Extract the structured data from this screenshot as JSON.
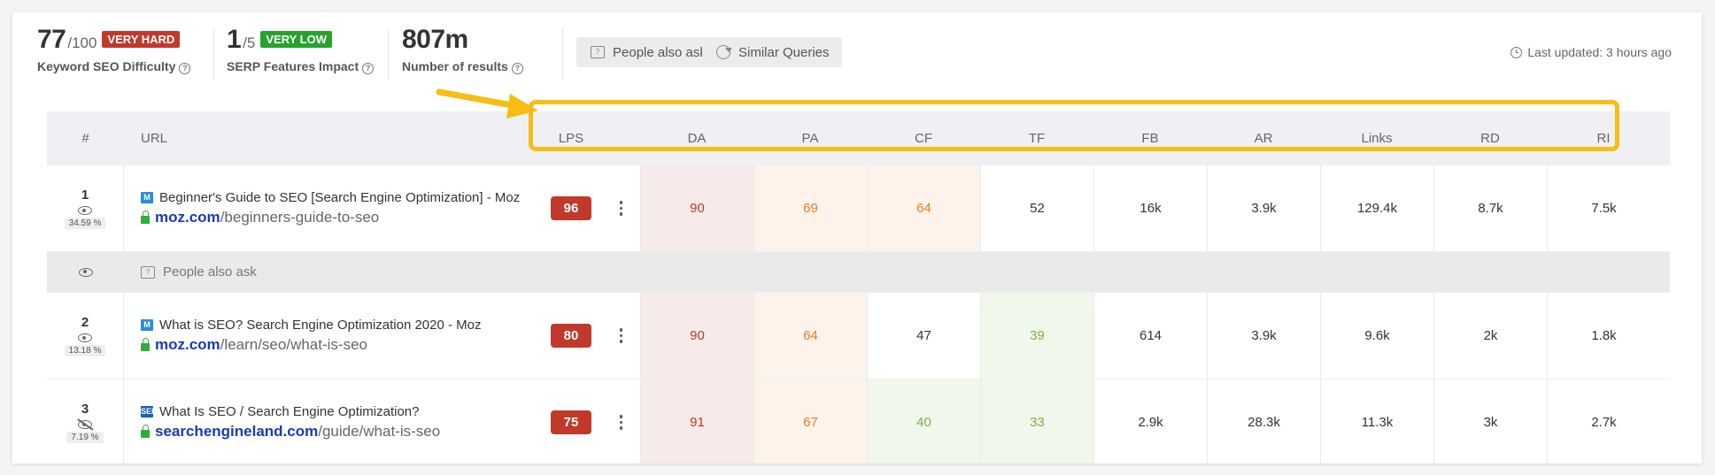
{
  "metrics": {
    "difficulty": {
      "value": "77",
      "of": "/100",
      "badge": "VERY HARD",
      "badge_color": "#c0392b",
      "label": "Keyword SEO Difficulty"
    },
    "serp": {
      "value": "1",
      "of": "/5",
      "badge": "VERY LOW",
      "badge_color": "#27a22c",
      "label": "SERP Features Impact"
    },
    "results": {
      "value": "807m",
      "label": "Number of results"
    }
  },
  "buttons": {
    "people_also_ask": "People also ask",
    "similar_queries": "Similar Queries"
  },
  "last_updated": "Last updated: 3 hours ago",
  "table": {
    "headers": {
      "num": "#",
      "url": "URL",
      "lps": "LPS",
      "metrics": [
        "DA",
        "PA",
        "CF",
        "TF",
        "FB",
        "AR",
        "Links",
        "RD",
        "RI"
      ]
    },
    "paa_label": "People also ask",
    "rows": [
      {
        "num": "1",
        "pct": "34.59 %",
        "favicon": "M",
        "title": "Beginner's Guide to SEO [Search Engine Optimization] - Moz",
        "domain": "moz.com",
        "path": "/beginners-guide-to-seo",
        "lps": "96",
        "metrics": [
          {
            "v": "90",
            "tone": "red"
          },
          {
            "v": "69",
            "tone": "orange"
          },
          {
            "v": "64",
            "tone": "orange"
          },
          {
            "v": "52",
            "tone": "none"
          },
          {
            "v": "16k",
            "tone": "none"
          },
          {
            "v": "3.9k",
            "tone": "none"
          },
          {
            "v": "129.4k",
            "tone": "none"
          },
          {
            "v": "8.7k",
            "tone": "none"
          },
          {
            "v": "7.5k",
            "tone": "none"
          }
        ]
      },
      {
        "num": "2",
        "pct": "13.18 %",
        "favicon": "M",
        "title": "What is SEO? Search Engine Optimization 2020 - Moz",
        "domain": "moz.com",
        "path": "/learn/seo/what-is-seo",
        "lps": "80",
        "metrics": [
          {
            "v": "90",
            "tone": "red"
          },
          {
            "v": "64",
            "tone": "orange"
          },
          {
            "v": "47",
            "tone": "none"
          },
          {
            "v": "39",
            "tone": "green"
          },
          {
            "v": "614",
            "tone": "none"
          },
          {
            "v": "3.9k",
            "tone": "none"
          },
          {
            "v": "9.6k",
            "tone": "none"
          },
          {
            "v": "2k",
            "tone": "none"
          },
          {
            "v": "1.8k",
            "tone": "none"
          }
        ]
      },
      {
        "num": "3",
        "pct": "7.19 %",
        "favicon": "SEL",
        "title": "What Is SEO / Search Engine Optimization?",
        "domain": "searchengineland.com",
        "path": "/guide/what-is-seo",
        "lps": "75",
        "metrics": [
          {
            "v": "91",
            "tone": "red"
          },
          {
            "v": "67",
            "tone": "orange"
          },
          {
            "v": "40",
            "tone": "green"
          },
          {
            "v": "33",
            "tone": "green"
          },
          {
            "v": "2.9k",
            "tone": "none"
          },
          {
            "v": "28.3k",
            "tone": "none"
          },
          {
            "v": "11.3k",
            "tone": "none"
          },
          {
            "v": "3k",
            "tone": "none"
          },
          {
            "v": "2.7k",
            "tone": "none"
          }
        ]
      }
    ]
  },
  "colors": {
    "highlight": "#f6bd15",
    "lps_badge": "#c0392b",
    "link": "#1a3bb3"
  }
}
